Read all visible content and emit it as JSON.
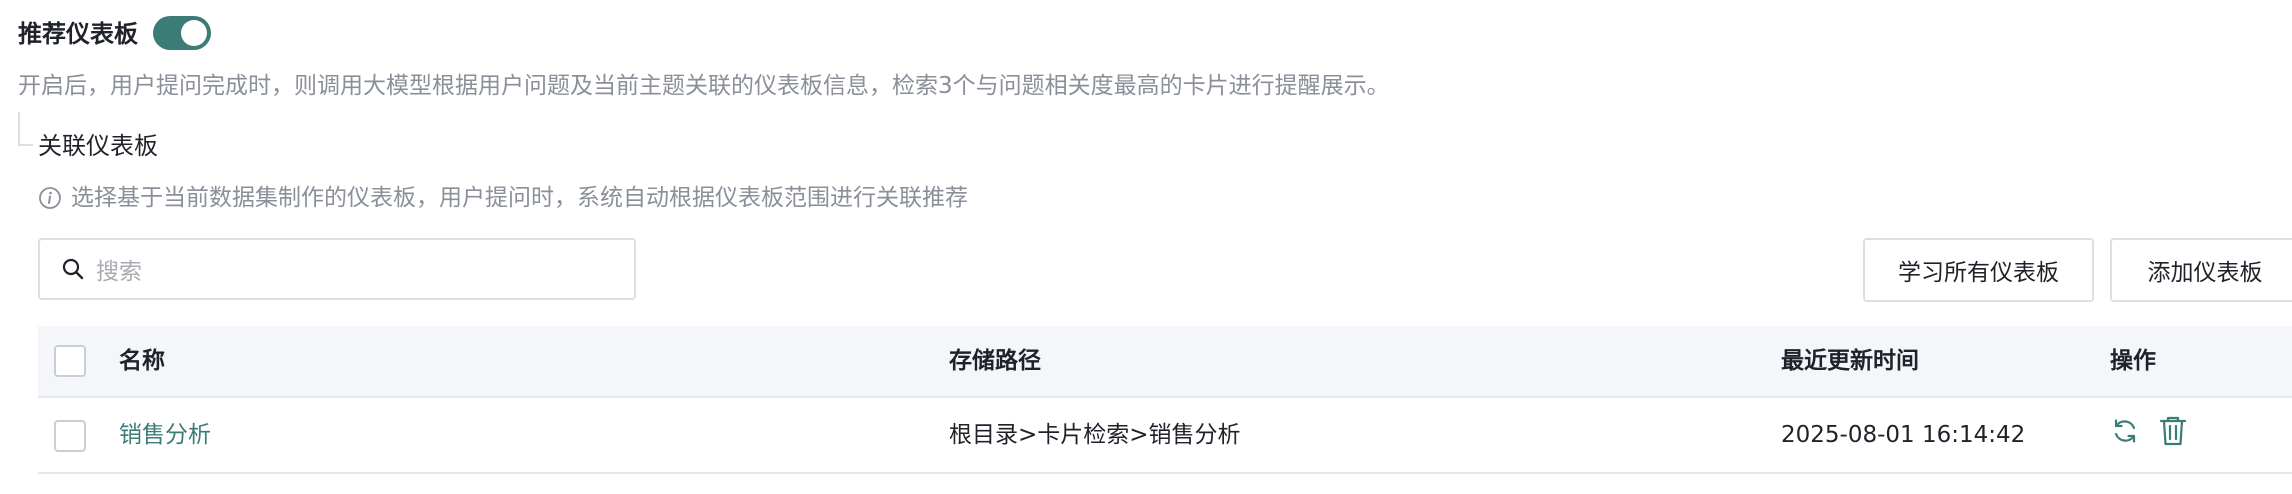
{
  "recommend": {
    "title": "推荐仪表板",
    "enabled": true,
    "description": "开启后，用户提问完成时，则调用大模型根据用户问题及当前主题关联的仪表板信息，检索3个与问题相关度最高的卡片进行提醒展示。"
  },
  "related": {
    "title": "关联仪表板",
    "hint": "选择基于当前数据集制作的仪表板，用户提问时，系统自动根据仪表板范围进行关联推荐"
  },
  "search": {
    "placeholder": "搜索"
  },
  "toolbar": {
    "learn_all_label": "学习所有仪表板",
    "add_label": "添加仪表板"
  },
  "table": {
    "columns": {
      "name": "名称",
      "path": "存储路径",
      "updated": "最近更新时间",
      "actions": "操作"
    },
    "rows": [
      {
        "name": "销售分析",
        "path": "根目录>卡片检索>销售分析",
        "updated": "2025-08-01 16:14:42",
        "actions": [
          "refresh-icon",
          "delete-icon"
        ]
      }
    ]
  },
  "colors": {
    "accent": "#3b7c76",
    "muted_text": "#8a8f99",
    "header_bg": "#f4f6f9",
    "border": "#dcdfe6"
  }
}
